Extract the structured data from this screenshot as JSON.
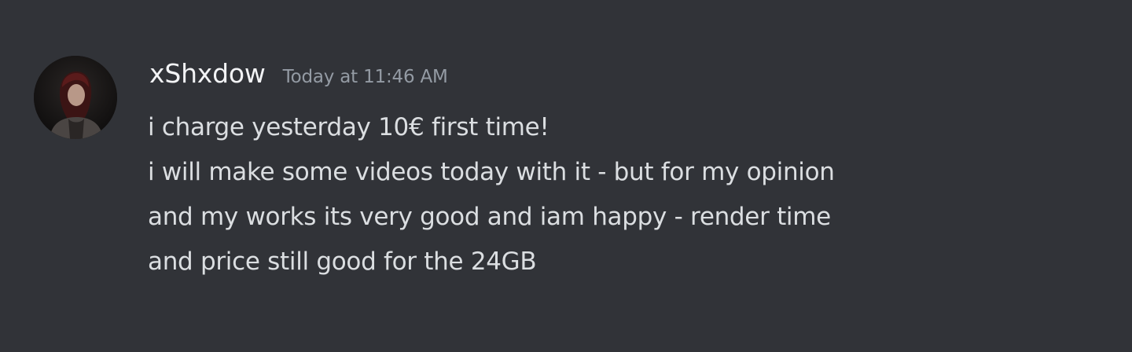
{
  "message": {
    "author": "xShxdow",
    "timestamp": "Today at 11:46 AM",
    "lines": [
      "i charge yesterday 10€ first time!",
      "i will make some videos today with it - but for my opinion",
      "and my works its very good and iam happy - render time",
      "and price still good for the 24GB"
    ],
    "avatar_icon": "user-avatar-photo"
  },
  "colors": {
    "background": "#313338",
    "username": "#f2f3f5",
    "timestamp": "#949ba4",
    "text": "#dbdee1"
  }
}
